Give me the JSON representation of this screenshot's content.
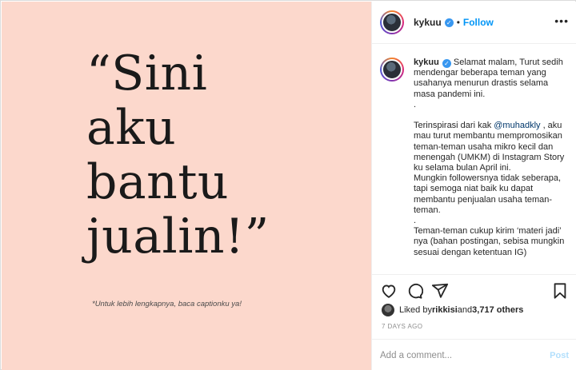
{
  "image": {
    "quote_lines": [
      "“Sini",
      "aku",
      "bantu",
      "jualin!”"
    ],
    "note": "*Untuk lebih lengkapnya, baca captionku ya!",
    "background": "#fcd8cc"
  },
  "header": {
    "username": "kykuu",
    "verified_glyph": "✓",
    "separator": "•",
    "follow_label": "Follow",
    "more_glyph": "•••"
  },
  "caption": {
    "username": "kykuu",
    "verified_glyph": "✓",
    "text_1": "Selamat malam, Turut sedih mendengar beberapa teman yang usahanya menurun drastis selama masa pandemi ini.\n.\n\nTerinspirasi dari kak ",
    "mention": "@muhadkly",
    "text_2": " , aku mau turut membantu mempromosikan teman-teman usaha mikro kecil dan menengah (UMKM) di Instagram Story ku selama bulan April ini.\nMungkin followersnya tidak seberapa, tapi semoga niat baik ku dapat membantu penjualan usaha teman-teman.\n.\nTeman-teman cukup kirim ‘materi jadi’ nya (bahan postingan, sebisa mungkin sesuai dengan ketentuan IG)"
  },
  "actions": {
    "icons": [
      "heart-icon",
      "comment-icon",
      "share-icon",
      "bookmark-icon"
    ]
  },
  "likes": {
    "prefix": "Liked by ",
    "user": "rikkisi",
    "middle": " and ",
    "count": "3,717 others"
  },
  "timestamp": "7 DAYS AGO",
  "add_comment": {
    "placeholder": "Add a comment...",
    "post_label": "Post"
  },
  "colors": {
    "accent": "#0095f6",
    "verified": "#3897f0",
    "post_disabled": "#b2dffc"
  }
}
